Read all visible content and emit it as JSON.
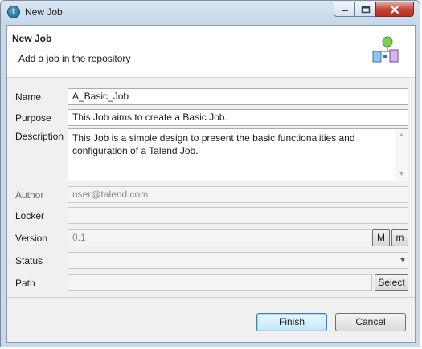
{
  "window": {
    "title": "New Job",
    "icon": "talend-icon",
    "controls": {
      "minimize": "minimize-icon",
      "maximize": "maximize-icon",
      "close": "close-icon"
    }
  },
  "header": {
    "title": "New Job",
    "subtitle": "Add a job in the repository",
    "icon": "job-wizard-icon"
  },
  "form": {
    "name": {
      "label": "Name",
      "value": "A_Basic_Job"
    },
    "purpose": {
      "label": "Purpose",
      "value": "This Job aims to create a Basic Job."
    },
    "description": {
      "label": "Description",
      "value": "This Job is a simple design to present the basic functionalities and\nconfiguration of a Talend Job."
    },
    "author": {
      "label": "Author",
      "value": "user@talend.com"
    },
    "locker": {
      "label": "Locker",
      "value": ""
    },
    "version": {
      "label": "Version",
      "value": "0.1",
      "major_button": "M",
      "minor_button": "m"
    },
    "status": {
      "label": "Status",
      "value": ""
    },
    "path": {
      "label": "Path",
      "value": "",
      "select_button": "Select"
    }
  },
  "buttons": {
    "finish": "Finish",
    "cancel": "Cancel"
  },
  "colors": {
    "titlebar": "#c6d6ea",
    "close_button": "#c4473a",
    "default_button_border": "#3c7fb1"
  }
}
